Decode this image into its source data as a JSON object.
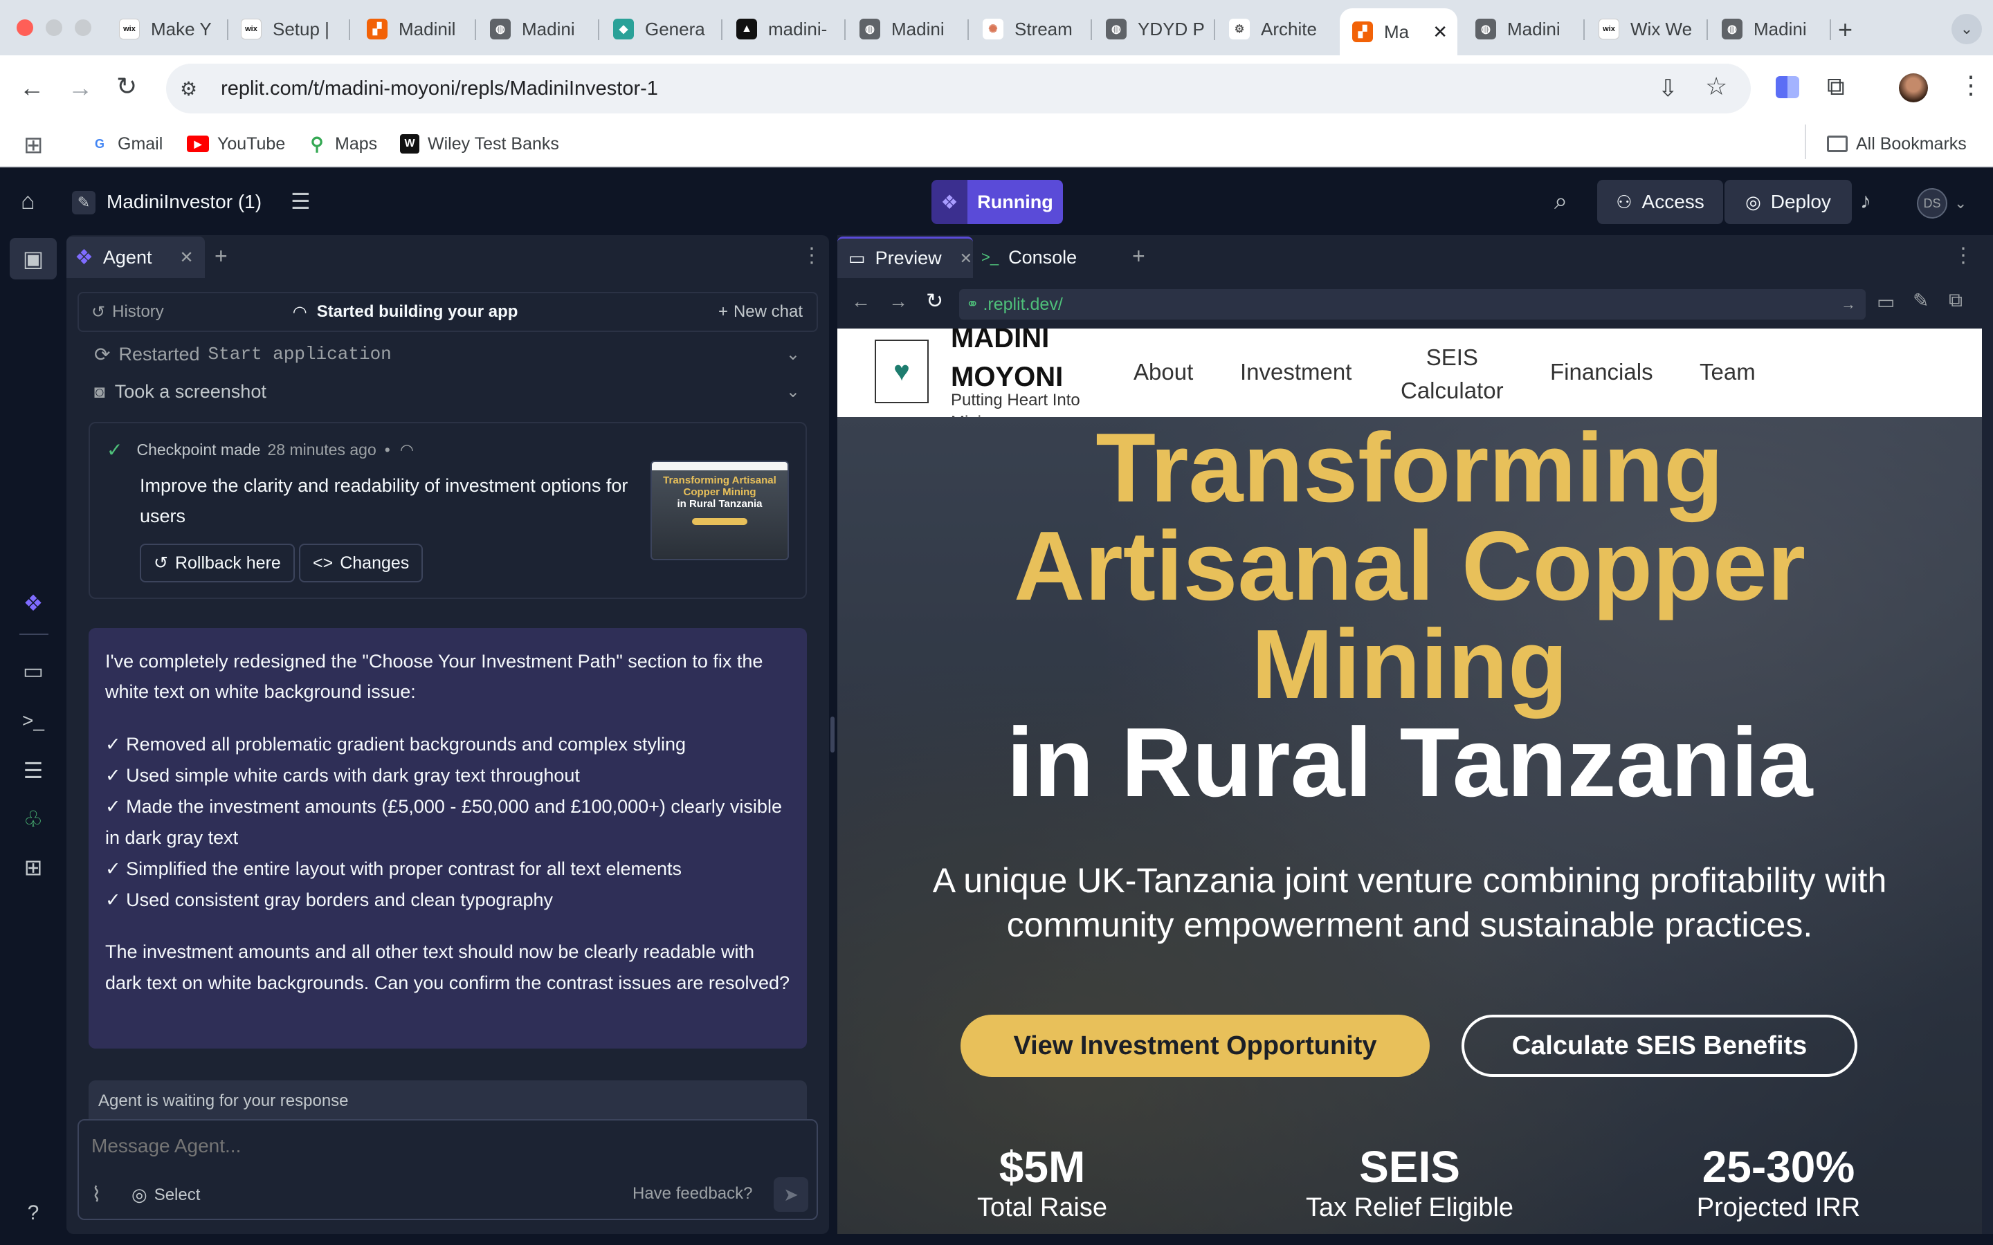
{
  "browser": {
    "tabs": [
      {
        "label": "Make Y",
        "icon": "wix-icon"
      },
      {
        "label": "Setup |",
        "icon": "wix-icon"
      },
      {
        "label": "Madinil",
        "icon": "replit-icon"
      },
      {
        "label": "Madini",
        "icon": "globe-icon"
      },
      {
        "label": "Genera",
        "icon": "diamond-icon"
      },
      {
        "label": "madini-",
        "icon": "triangle-icon"
      },
      {
        "label": "Madini",
        "icon": "globe-icon"
      },
      {
        "label": "Stream",
        "icon": "spark-icon"
      },
      {
        "label": "YDYD P",
        "icon": "globe-icon"
      },
      {
        "label": "Archite",
        "icon": "architect-icon"
      },
      {
        "label": "Ma",
        "icon": "replit-icon"
      },
      {
        "label": "Madini",
        "icon": "globe-icon"
      },
      {
        "label": "Wix We",
        "icon": "wix-icon"
      },
      {
        "label": "Madini",
        "icon": "globe-icon"
      }
    ],
    "url": "replit.com/t/madini-moyoni/repls/MadiniInvestor-1",
    "bookmarks": [
      {
        "label": "Gmail",
        "icon": "google-icon"
      },
      {
        "label": "YouTube",
        "icon": "youtube-icon"
      },
      {
        "label": "Maps",
        "icon": "maps-icon"
      },
      {
        "label": "Wiley Test Banks",
        "icon": "wiley-icon"
      }
    ],
    "all_bookmarks": "All Bookmarks"
  },
  "replit": {
    "project_name": "MadiniInvestor (1)",
    "run_status": "Running",
    "access_label": "Access",
    "deploy_label": "Deploy",
    "avatar_initials": "DS",
    "accent": "#5a4bd8"
  },
  "agent": {
    "tab_label": "Agent",
    "history_label": "History",
    "status": "Started building your app",
    "new_chat_label": "New chat",
    "restarted_prefix": "Restarted",
    "restarted_code": "Start application",
    "screenshot_label": "Took a screenshot",
    "checkpoint_label": "Checkpoint made",
    "checkpoint_time": "28 minutes ago",
    "checkpoint_desc": "Improve the clarity and readability of investment options for users",
    "rollback_label": "Rollback here",
    "changes_label": "Changes",
    "thumb_title_1": "Transforming Artisanal",
    "thumb_title_2": "Copper Mining",
    "thumb_title_3": "in Rural Tanzania",
    "message_intro": "I've completely redesigned the \"Choose Your Investment Path\" section to fix the white text on white background issue:",
    "message_items": [
      "✓ Removed all problematic gradient backgrounds and complex styling",
      "✓ Used simple white cards with dark gray text throughout",
      "✓ Made the investment amounts (£5,000 - £50,000 and £100,000+) clearly visible in dark gray text",
      "✓ Simplified the entire layout with proper contrast for all text elements",
      "✓ Used consistent gray borders and clean typography"
    ],
    "message_outro": "The investment amounts and all other text should now be clearly readable with dark text on white backgrounds. Can you confirm the contrast issues are resolved?",
    "waiting": "Agent is waiting for your response",
    "input_placeholder": "Message Agent...",
    "select_label": "Select",
    "feedback_label": "Have feedback?"
  },
  "preview": {
    "tab_preview": "Preview",
    "tab_console": "Console",
    "url": ".replit.dev/",
    "site": {
      "brand_line1": "MADINI",
      "brand_line2": "MOYONI",
      "tagline": "Putting Heart Into",
      "tagline_cut": "Mining",
      "nav": [
        "About",
        "Investment",
        "SEIS",
        "Calculator",
        "Financials",
        "Team"
      ],
      "hero_gold_1": "Transforming",
      "hero_gold_2": "Artisanal Copper",
      "hero_gold_3": "Mining",
      "hero_white": "in Rural Tanzania",
      "subtitle_1": "A unique UK-Tanzania joint venture combining profitability with",
      "subtitle_2": "community empowerment and sustainable practices.",
      "cta_primary": "View Investment Opportunity",
      "cta_secondary": "Calculate SEIS Benefits",
      "stats": [
        {
          "value": "$5M",
          "label": "Total Raise"
        },
        {
          "value": "SEIS",
          "label": "Tax Relief Eligible"
        },
        {
          "value": "25-30%",
          "label": "Projected IRR"
        }
      ],
      "gold": "#e8c05a"
    }
  }
}
